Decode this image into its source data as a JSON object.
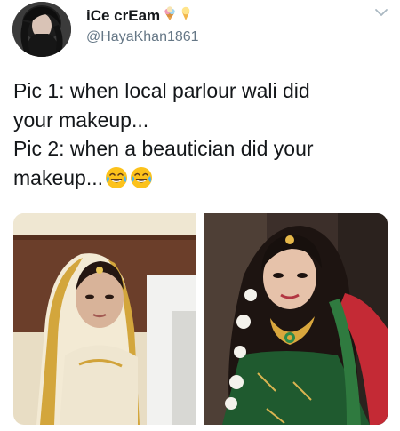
{
  "tweet": {
    "display_name": "iCe crEam",
    "name_emojis": [
      "ice-cream-emoji",
      "cone-emoji"
    ],
    "handle": "@HayaKhan1861",
    "text_lines": [
      "Pic 1: when local parlour wali did",
      "your makeup...",
      "Pic 2: when a beautician did your",
      "makeup..."
    ],
    "trailing_emojis": [
      "face-with-tears-of-joy-emoji",
      "face-with-tears-of-joy-emoji"
    ]
  },
  "media": [
    {
      "label": "pic-1"
    },
    {
      "label": "pic-2"
    }
  ],
  "colors": {
    "text": "#14171a",
    "secondary": "#657786",
    "caret": "#aab8c2"
  }
}
